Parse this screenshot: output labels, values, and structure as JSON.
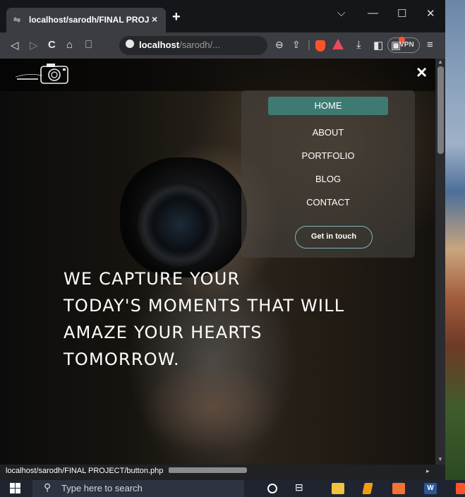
{
  "browser": {
    "tab_title": "localhost/sarodh/FINAL PROJECT",
    "tab_close": "×",
    "new_tab": "+",
    "address_host": "localhost",
    "address_path": "/sarodh/...",
    "vpn_label": "● VPN"
  },
  "site": {
    "close_symbol": "×",
    "menu": {
      "items": [
        "HOME",
        "ABOUT",
        "PORTFOLIO",
        "BLOG",
        "CONTACT"
      ],
      "active": "HOME",
      "cta": "Get in touch"
    },
    "hero_lines": [
      "WE CAPTURE YOUR",
      "TODAY'S MOMENTS THAT WILL",
      "AMAZE YOUR HEARTS",
      "TOMORROW."
    ]
  },
  "status_url": "localhost/sarodh/FINAL PROJECT/button.php",
  "taskbar": {
    "search_placeholder": "Type here to search"
  },
  "colors": {
    "menu_active_bg": "#3f7a72",
    "cta_border": "#7ab8c0",
    "brave_orange": "#fb542b"
  }
}
